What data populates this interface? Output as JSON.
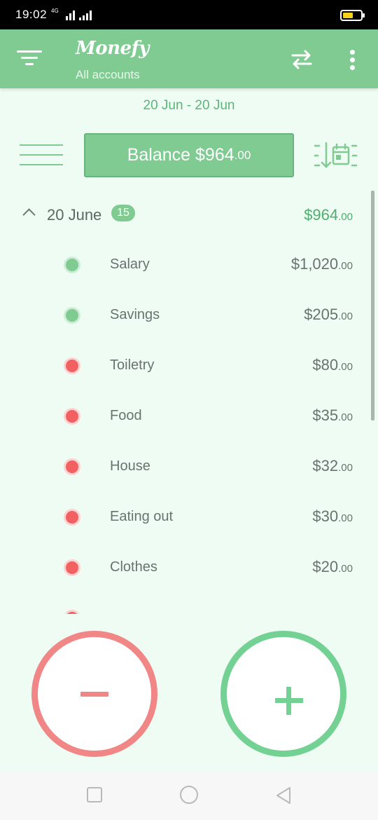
{
  "status_bar": {
    "time": "19:02",
    "network": "4G",
    "battery_color": "#f4d21e"
  },
  "app_bar": {
    "title": "Monefy",
    "subtitle": "All accounts",
    "color": "#7fcb92",
    "icons": [
      "filter-icon",
      "transfer-icon",
      "more-vert-icon"
    ]
  },
  "date_range": "20 Jun - 20 Jun",
  "balance": {
    "label": "Balance",
    "amount_main": "$964",
    "amount_cents": ".00"
  },
  "group": {
    "date": "20 June",
    "count": "15",
    "total_main": "$964",
    "total_cents": ".00"
  },
  "transactions": [
    {
      "category": "Salary",
      "amount_main": "$1,020",
      "amount_cents": ".00",
      "type": "income"
    },
    {
      "category": "Savings",
      "amount_main": "$205",
      "amount_cents": ".00",
      "type": "income"
    },
    {
      "category": "Toiletry",
      "amount_main": "$80",
      "amount_cents": ".00",
      "type": "expense"
    },
    {
      "category": "Food",
      "amount_main": "$35",
      "amount_cents": ".00",
      "type": "expense"
    },
    {
      "category": "House",
      "amount_main": "$32",
      "amount_cents": ".00",
      "type": "expense"
    },
    {
      "category": "Eating out",
      "amount_main": "$30",
      "amount_cents": ".00",
      "type": "expense"
    },
    {
      "category": "Clothes",
      "amount_main": "$20",
      "amount_cents": ".00",
      "type": "expense"
    }
  ],
  "colors": {
    "income": "#7fcb92",
    "expense": "#f26161",
    "expense_button": "#f08686",
    "income_button": "#73d193",
    "background": "#effcf3"
  },
  "bottom_actions": {
    "expense_icon": "minus-icon",
    "income_icon": "plus-icon"
  },
  "nav_bar": {
    "icons": [
      "recents-square-icon",
      "home-circle-icon",
      "back-triangle-icon"
    ]
  }
}
